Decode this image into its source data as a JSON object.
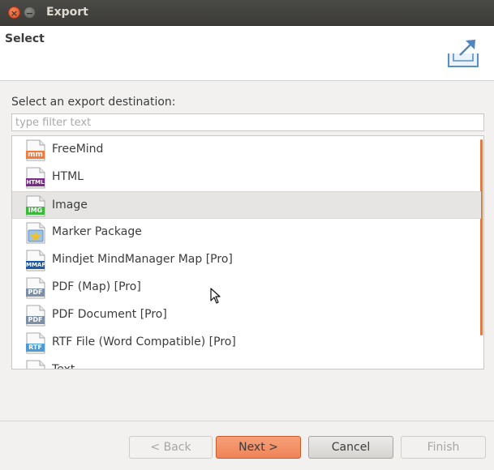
{
  "window": {
    "title": "Export",
    "close_glyph": "×",
    "minimize_glyph": "−"
  },
  "header": {
    "title": "Select",
    "icon": "export-box-arrow-icon"
  },
  "prompt": "Select an export destination:",
  "filter": {
    "placeholder": "type filter text",
    "value": ""
  },
  "destinations": [
    {
      "label": "FreeMind",
      "badge": "mm",
      "badge_color": "#f07b3f",
      "icon": "freemind-file-icon"
    },
    {
      "label": "HTML",
      "badge": "HTML",
      "badge_color": "#7b2a8c",
      "icon": "html-file-icon"
    },
    {
      "label": "Image",
      "badge": "IMG",
      "badge_color": "#3cb93c",
      "icon": "image-file-icon",
      "selected": true
    },
    {
      "label": "Marker Package",
      "badge": "",
      "badge_color": "#f0c12e",
      "icon": "marker-package-icon"
    },
    {
      "label": "Mindjet MindManager Map [Pro]",
      "badge": "MMAP",
      "badge_color": "#1e5aa8",
      "icon": "mmap-file-icon"
    },
    {
      "label": "PDF (Map) [Pro]",
      "badge": "PDF",
      "badge_color": "#7d8fa6",
      "icon": "pdf-file-icon"
    },
    {
      "label": "PDF Document [Pro]",
      "badge": "PDF",
      "badge_color": "#7d8fa6",
      "icon": "pdf-file-icon"
    },
    {
      "label": "RTF File (Word Compatible) [Pro]",
      "badge": "RTF",
      "badge_color": "#4d9bd6",
      "icon": "rtf-file-icon"
    },
    {
      "label": "Text",
      "badge": "",
      "badge_color": "#b0b0b0",
      "icon": "text-file-icon"
    }
  ],
  "buttons": {
    "back": "< Back",
    "next": "Next >",
    "cancel": "Cancel",
    "finish": "Finish"
  },
  "colors": {
    "accent": "#ef8457",
    "selection": "#e6e5e3",
    "titlebar": "#3c3b37"
  }
}
